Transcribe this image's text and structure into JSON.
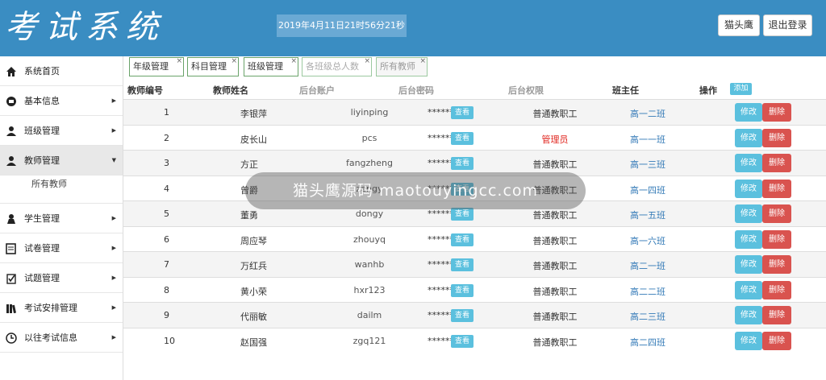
{
  "app": {
    "title": "考试系统"
  },
  "header": {
    "datetime": "2019年4月11日21时56分21秒",
    "user_label": "猫头鹰",
    "logout_label": "退出登录"
  },
  "sidebar": {
    "items": [
      {
        "label": "系统首页",
        "icon": "home-icon",
        "arrow": ""
      },
      {
        "label": "基本信息",
        "icon": "info-icon",
        "arrow": "▶"
      },
      {
        "label": "班级管理",
        "icon": "class-icon",
        "arrow": "▶"
      },
      {
        "label": "教师管理",
        "icon": "teacher-icon",
        "arrow": "▼"
      },
      {
        "label": "学生管理",
        "icon": "student-icon",
        "arrow": "▶"
      },
      {
        "label": "试卷管理",
        "icon": "paper-icon",
        "arrow": "▶"
      },
      {
        "label": "试题管理",
        "icon": "question-icon",
        "arrow": "▶"
      },
      {
        "label": "考试安排管理",
        "icon": "schedule-icon",
        "arrow": "▶"
      },
      {
        "label": "以往考试信息",
        "icon": "clock-icon",
        "arrow": "▶"
      }
    ],
    "sub_item": "所有教师"
  },
  "tabs": [
    "年级管理",
    "科目管理",
    "班级管理",
    "各班级总人数",
    "所有教师"
  ],
  "tab_close": "×",
  "table": {
    "headers": [
      "教师编号",
      "教师姓名",
      "后台账户",
      "后台密码",
      "后台权限",
      "班主任",
      "操作"
    ],
    "add_label": "添加",
    "view_label": "查看",
    "edit_label": "修改",
    "delete_label": "删除",
    "rows": [
      {
        "id": "1",
        "name": "李银萍",
        "account": "liyinping",
        "password": "******",
        "permission": "普通教职工",
        "class": "高一二班"
      },
      {
        "id": "2",
        "name": "皮长山",
        "account": "pcs",
        "password": "******",
        "permission": "管理员",
        "class": "高一一班"
      },
      {
        "id": "3",
        "name": "方正",
        "account": "fangzheng",
        "password": "******",
        "permission": "普通教职工",
        "class": "高一三班"
      },
      {
        "id": "4",
        "name": "曾爵",
        "account": "zengy",
        "password": "******",
        "permission": "普通教职工",
        "class": "高一四班"
      },
      {
        "id": "5",
        "name": "董勇",
        "account": "dongy",
        "password": "******",
        "permission": "普通教职工",
        "class": "高一五班"
      },
      {
        "id": "6",
        "name": "周应琴",
        "account": "zhouyq",
        "password": "******",
        "permission": "普通教职工",
        "class": "高一六班"
      },
      {
        "id": "7",
        "name": "万红兵",
        "account": "wanhb",
        "password": "******",
        "permission": "普通教职工",
        "class": "高二一班"
      },
      {
        "id": "8",
        "name": "黄小荣",
        "account": "hxr123",
        "password": "******",
        "permission": "普通教职工",
        "class": "高二二班"
      },
      {
        "id": "9",
        "name": "代丽敏",
        "account": "dailm",
        "password": "******",
        "permission": "普通教职工",
        "class": "高二三班"
      },
      {
        "id": "10",
        "name": "赵国强",
        "account": "zgq121",
        "password": "******",
        "permission": "普通教职工",
        "class": "高二四班"
      }
    ]
  },
  "watermark": "猫头鹰源码 maotouyingcc.com",
  "colors": {
    "header_bg": "#3a8dc2",
    "info": "#5bc0de",
    "danger": "#d9534f",
    "admin_text": "#e0261f",
    "link": "#337ab7"
  }
}
